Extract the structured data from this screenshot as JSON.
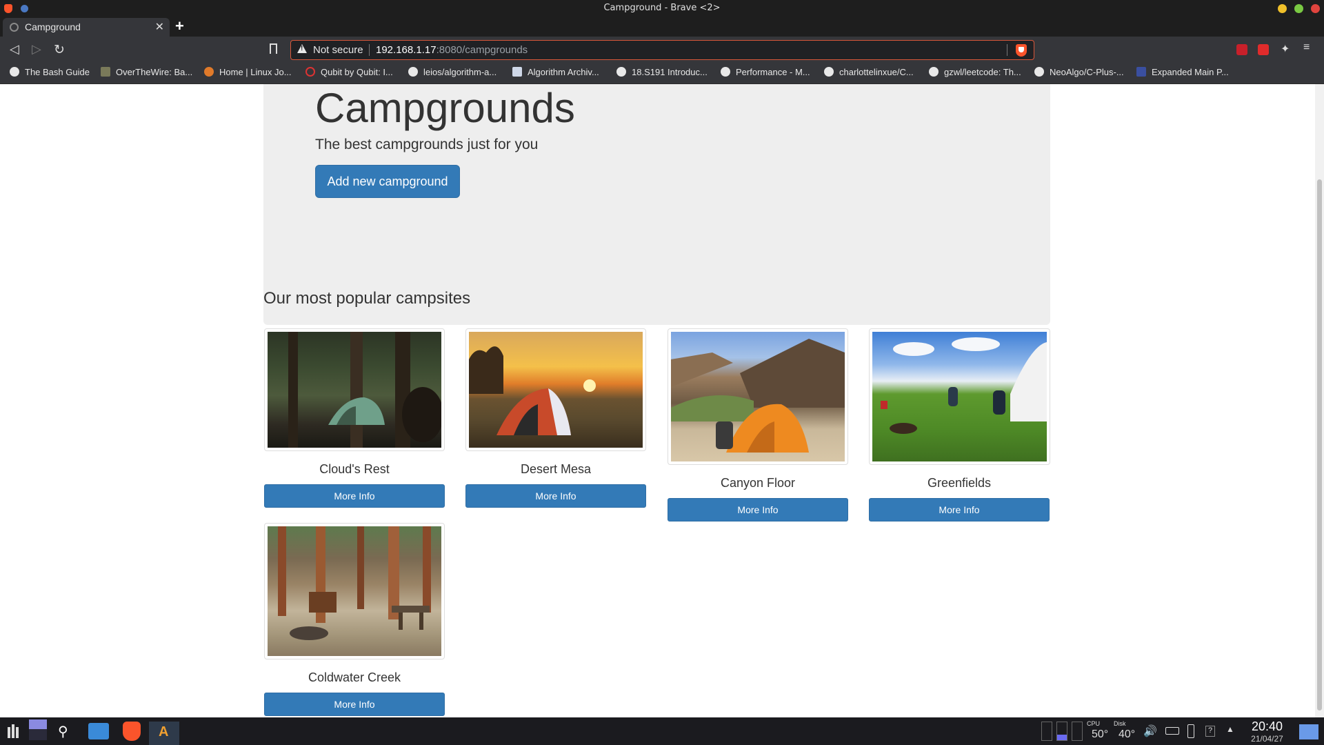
{
  "window": {
    "title": "Campground - Brave <2>"
  },
  "tab": {
    "title": "Campground",
    "close": "✕",
    "new_tab": "+"
  },
  "address": {
    "security": "Not secure",
    "host": "192.168.1.17",
    "path": ":8080/campgrounds"
  },
  "bookmarks": [
    "The Bash Guide",
    "OverTheWire: Ba...",
    "Home | Linux Jo...",
    "Qubit by Qubit: I...",
    "leios/algorithm-a...",
    "Algorithm Archiv...",
    "18.S191 Introduc...",
    "Performance - M...",
    "charlottelinxue/C...",
    "gzwl/leetcode: Th...",
    "NeoAlgo/C-Plus-...",
    "Expanded Main P..."
  ],
  "page": {
    "title": "Campgrounds",
    "subtitle": "The best campgrounds just for you",
    "add_button": "Add new campground",
    "section_title": "Our most popular campsites",
    "more_info": "More Info",
    "campgrounds": [
      {
        "name": "Cloud's Rest"
      },
      {
        "name": "Desert Mesa"
      },
      {
        "name": "Canyon Floor"
      },
      {
        "name": "Greenfields"
      },
      {
        "name": "Coldwater Creek"
      }
    ]
  },
  "taskbar": {
    "cpu_label": "CPU",
    "cpu_temp": "50°",
    "disk_label": "Disk",
    "disk_temp": "40°",
    "time": "20:40",
    "date": "21/04/27"
  }
}
